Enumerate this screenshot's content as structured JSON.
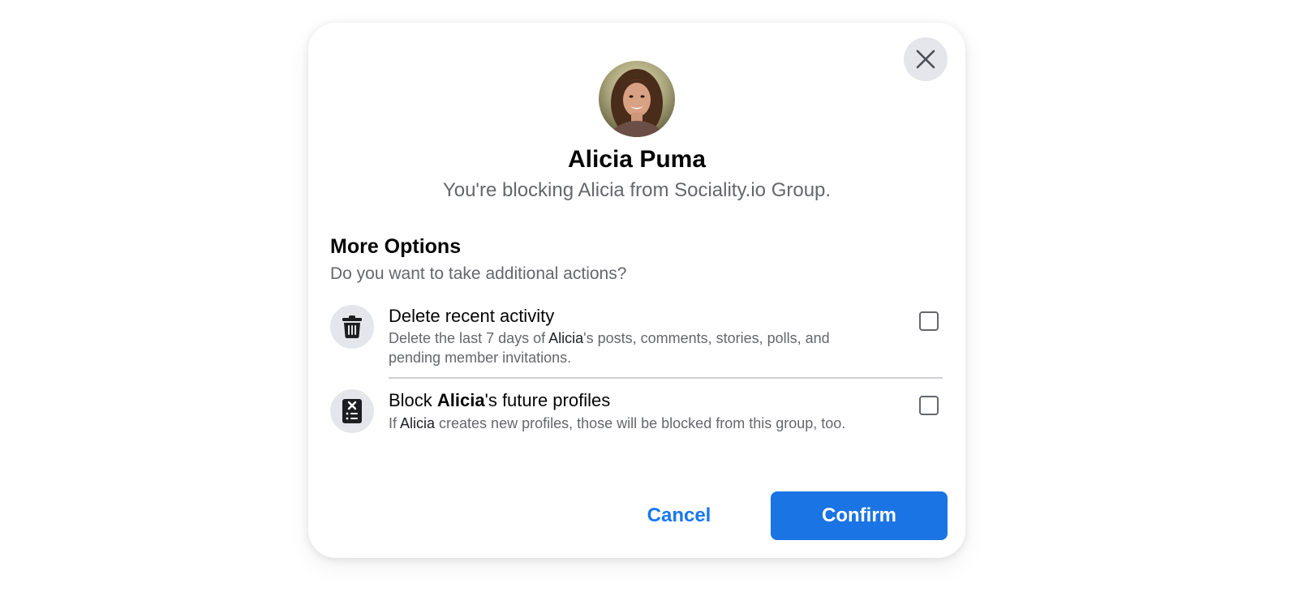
{
  "dialog": {
    "close_icon": "close-icon",
    "avatar_icon": "user-avatar",
    "name": "Alicia Puma",
    "subtitle": "You're blocking Alicia from Sociality.io Group."
  },
  "more_options": {
    "title": "More Options",
    "subtitle": "Do you want to take additional actions?",
    "options": [
      {
        "icon": "trash-icon",
        "title": "Delete recent activity",
        "desc_pre": "Delete the last 7 days of ",
        "desc_name": "Alicia",
        "desc_post": "'s posts, comments, stories, polls, and pending member invitations.",
        "checked": false
      },
      {
        "icon": "block-profile-icon",
        "title_pre": "Block ",
        "title_name": "Alicia",
        "title_post": "'s future profiles",
        "desc_pre": "If ",
        "desc_name": "Alicia",
        "desc_post": " creates new profiles, those will be blocked from this group, too.",
        "checked": false
      }
    ]
  },
  "actions": {
    "cancel_label": "Cancel",
    "confirm_label": "Confirm"
  },
  "colors": {
    "primary": "#1b74e4",
    "link": "#1877f2",
    "secondary_text": "#65676b",
    "icon_bg": "#e4e6eb"
  }
}
